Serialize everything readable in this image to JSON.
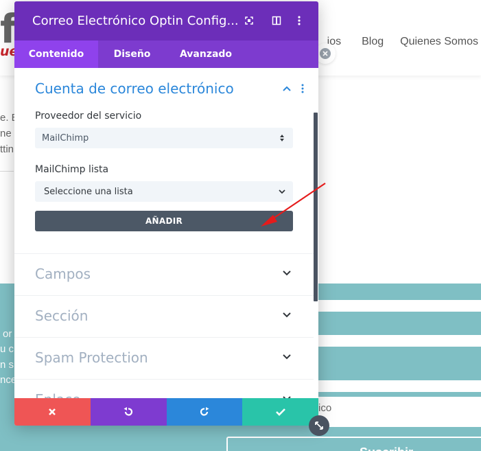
{
  "site": {
    "logo_text": "fc",
    "logo_sub": "uel",
    "nav": [
      "ios",
      "Blog",
      "Quienes Somos"
    ],
    "text_fragments_left": [
      "e. E",
      "ne",
      "ttin"
    ],
    "teal_fragments_left": [
      "or",
      "u c",
      "n s",
      "nce"
    ],
    "teal_fragment_field": "ico",
    "subscribe_label": "Suscribir"
  },
  "modal": {
    "title": "Correo Electrónico Optin Config...",
    "tabs": [
      {
        "label": "Contenido",
        "active": true
      },
      {
        "label": "Diseño",
        "active": false
      },
      {
        "label": "Avanzado",
        "active": false
      }
    ],
    "open_section": {
      "title": "Cuenta de correo electrónico",
      "provider_label": "Proveedor del servicio",
      "provider_value": "MailChimp",
      "list_label": "MailChimp lista",
      "list_value": "Seleccione una lista",
      "add_button": "AÑADIR"
    },
    "collapsed_sections": [
      "Campos",
      "Sección",
      "Spam Protection",
      "Enlace"
    ]
  },
  "colors": {
    "header_purple": "#6c2eb9",
    "tab_purple": "#7d3bcf",
    "active_tab": "#8f42ec",
    "accent_blue": "#2b87da",
    "cancel_red": "#ef5555",
    "undo_purple": "#7e3bd0",
    "redo_blue": "#2b87da",
    "save_green": "#29c4a9",
    "teal_bg": "#7fbfc4",
    "annotation_red": "#e51b1b"
  },
  "icons": {
    "header": [
      "expand-icon",
      "split-view-icon",
      "more-vertical-icon"
    ],
    "footer": [
      "close-icon",
      "undo-icon",
      "redo-icon",
      "check-icon"
    ]
  }
}
